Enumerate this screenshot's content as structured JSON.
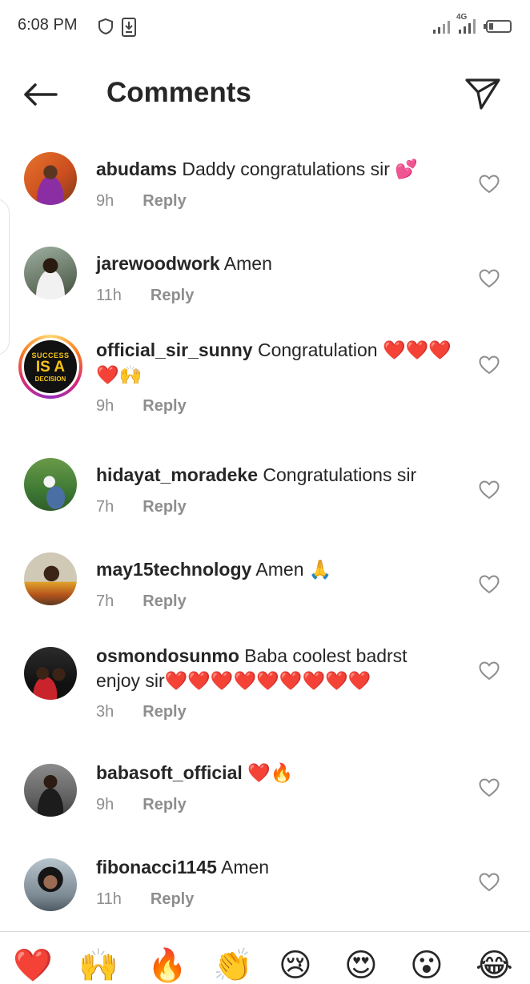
{
  "status_bar": {
    "time": "6:08 PM",
    "network": "4G",
    "icons": [
      "shield-icon",
      "download-icon",
      "signal-icon",
      "signal-icon",
      "battery-icon"
    ]
  },
  "header": {
    "title": "Comments",
    "back_icon": "arrow-left-icon",
    "send_icon": "paper-plane-icon"
  },
  "comments": [
    {
      "username": "abudams",
      "text": "Daddy congratulations sir 💕",
      "time": "9h",
      "reply": "Reply"
    },
    {
      "username": "jarewoodwork",
      "text": "Amen",
      "time": "11h",
      "reply": "Reply"
    },
    {
      "username": "official_sir_sunny",
      "text": "Congratulation ❤️❤️❤️❤️🙌",
      "time": "9h",
      "reply": "Reply",
      "avatar_text": [
        "SUCCESS",
        "IS A",
        "DECISION"
      ]
    },
    {
      "username": "hidayat_moradeke",
      "text": "Congratulations sir",
      "time": "7h",
      "reply": "Reply"
    },
    {
      "username": "may15technology",
      "text": "Amen 🙏",
      "time": "7h",
      "reply": "Reply"
    },
    {
      "username": "osmondosunmo",
      "text": "Baba coolest badrst enjoy sir❤️❤️❤️❤️❤️❤️❤️❤️❤️",
      "time": "3h",
      "reply": "Reply"
    },
    {
      "username": "babasoft_official",
      "text": "❤️🔥",
      "time": "9h",
      "reply": "Reply"
    },
    {
      "username": "fibonacci1145",
      "text": "Amen",
      "time": "11h",
      "reply": "Reply"
    }
  ],
  "emoji_bar": [
    "❤️",
    "🙌",
    "🔥",
    "👏",
    "😢",
    "😍",
    "😮",
    "😂"
  ],
  "colors": {
    "text": "#262626",
    "meta": "#8e8e8e",
    "like_outline": "#8e8e8e"
  }
}
